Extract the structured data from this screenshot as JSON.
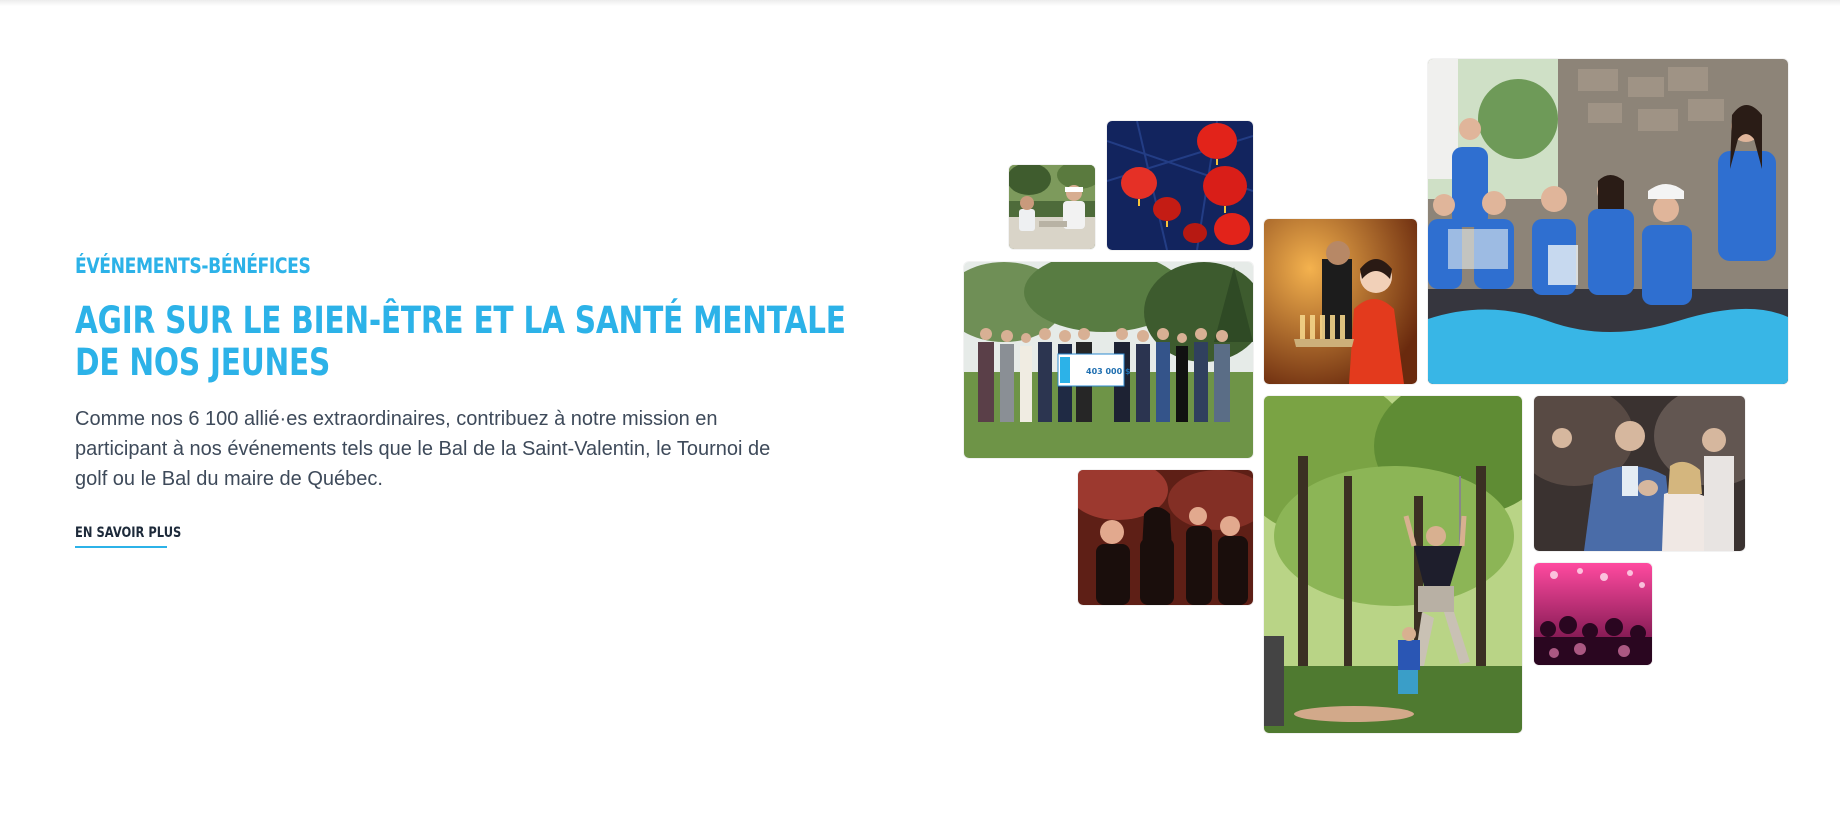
{
  "section": {
    "eyebrow": "ÉVÉNEMENTS-BÉNÉFICES",
    "title_line_1": "AGIR SUR LE BIEN-ÊTRE ET LA SANTÉ MENTALE",
    "title_line_2": "DE NOS JEUNES",
    "body_line_1": "Comme nos 6 100 allié·es extraordinaires, contribuez à notre mission en",
    "body_line_2": "participant à nos événements tels que le Bal de la Saint-Valentin, le Tournoi de",
    "body_line_3": "golf ou le Bal du maire de Québec.",
    "cta_label": "EN SAVOIR PLUS"
  },
  "colors": {
    "accent": "#2cb2e8",
    "body_text": "#3e4a5a",
    "cta_text": "#1d2a3a",
    "background": "#ffffff"
  },
  "photos": [
    {
      "id": "outdoor-table",
      "subject": "people seated at an outdoor table"
    },
    {
      "id": "red-lanterns",
      "subject": "red Chinese lanterns"
    },
    {
      "id": "cheque-presentation",
      "subject": "group holding a large cheque on a lawn",
      "cheque_amount": "403 000 $"
    },
    {
      "id": "champagne-server",
      "subject": "woman in red dress serving champagne"
    },
    {
      "id": "volunteer-table",
      "subject": "volunteers in blue shirts at a registration table"
    },
    {
      "id": "gala-dinner",
      "subject": "guests at a gala dinner"
    },
    {
      "id": "golf-swing",
      "subject": "golfer celebrating on a course"
    },
    {
      "id": "applauding-guests",
      "subject": "guests applauding at an event"
    },
    {
      "id": "party-crowd",
      "subject": "crowd at a pink-lit party"
    }
  ]
}
